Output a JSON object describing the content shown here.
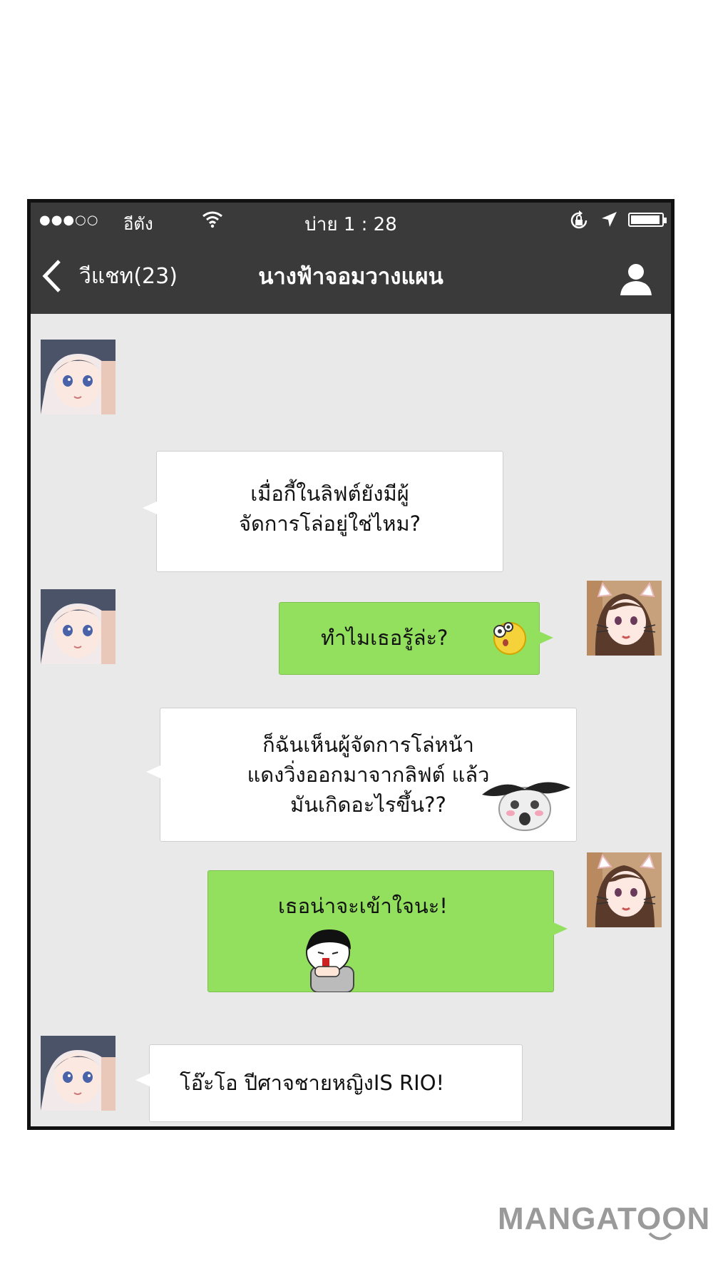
{
  "status_bar": {
    "signal": "●●●○○",
    "carrier": "อีตัง",
    "time": "บ่าย  1 : 28"
  },
  "nav": {
    "back_label": "วีแชท(23)",
    "title": "นางฟ้าจอมวางแผน"
  },
  "messages": [
    {
      "side": "left",
      "lines": [
        "เมื่อกี้ในลิฟต์ยังมีผู้",
        "จัดการโล่อยู่ใช่ไหม?"
      ]
    },
    {
      "side": "right",
      "text": "ทำไมเธอรู้ล่ะ?"
    },
    {
      "side": "left",
      "lines": [
        "ก็ฉันเห็นผู้จัดการโล่หน้า",
        "แดงวิ่งออกมาจากลิฟต์ แล้ว",
        "มันเกิดอะไรขึ้น??"
      ]
    },
    {
      "side": "right",
      "text": "เธอน่าจะเข้าใจนะ!"
    },
    {
      "side": "left",
      "text": "โอ๊ะโอ ปีศาจชายหญิงIS RIO!"
    }
  ],
  "brand": "MANGATOON",
  "colors": {
    "topbar": "#3a3a3a",
    "sent_bubble": "#93e05e",
    "received_bubble": "#ffffff",
    "chat_bg": "#e9e9e9",
    "brand": "#9a9a9a"
  }
}
